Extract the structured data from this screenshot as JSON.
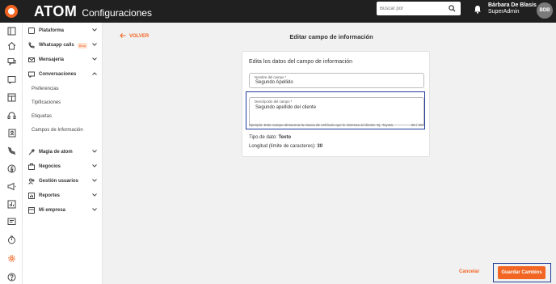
{
  "topbar": {
    "brand": "ATOM",
    "section": "Configuraciones",
    "search_placeholder": "Buscar por",
    "user_name": "Bárbara De Blasis",
    "user_role": "SuperAdmin",
    "avatar_initials": "BDB"
  },
  "sidebar": {
    "plataforma": "Plataforma",
    "whatsapp_calls": "Whatsapp calls",
    "whatsapp_badge": "Beta",
    "mensajeria": "Mensajería",
    "conversaciones": "Conversaciones",
    "sub": [
      "Preferencias",
      "Tipificaciones",
      "Etiquetas",
      "Campos de Información"
    ],
    "magia": "Magia de atom",
    "negocios": "Negocios",
    "gestion": "Gestión usuarios",
    "reportes": "Reportes",
    "empresa": "Mi empresa"
  },
  "main": {
    "back": "VOLVER",
    "title": "Editar campo de información",
    "card_title": "Edita los datos del campo de información",
    "name_label": "Nombre del campo *",
    "name_value": "Segundo Apellido",
    "desc_label": "Descripción del campo *",
    "desc_value": "Segundo apellido del cliente",
    "hint": "Ejemplo: Este campo almacena la marca de vehículo que le interesa al cliente. Ej. Toyota",
    "counter": "28 / 200",
    "type_label": "Tipo de dato: ",
    "type_value": "Texto",
    "length_label": "Longitud (límite de caracteres): ",
    "length_value": "30",
    "cancel": "Cancelar",
    "save": "Guardar Cambios"
  },
  "colors": {
    "accent": "#f26522",
    "topbar": "#202020",
    "highlight": "#1f3d99"
  }
}
